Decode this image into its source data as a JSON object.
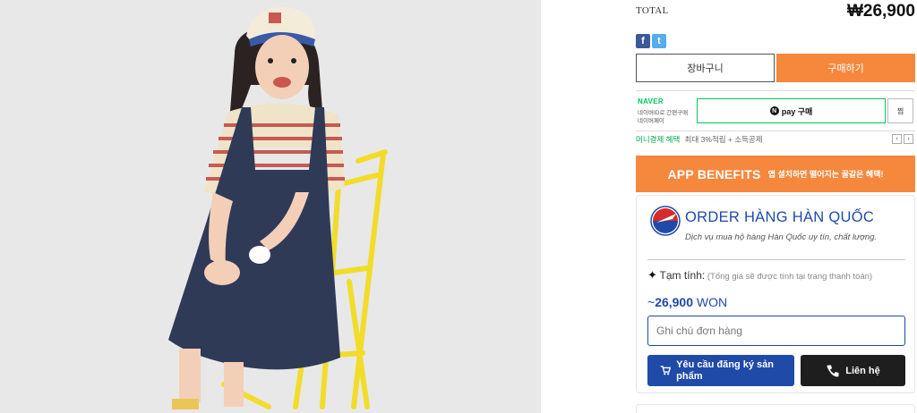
{
  "total": {
    "label": "TOTAL",
    "price": "₩26,900"
  },
  "share": {
    "facebook_glyph": "f",
    "twitter_glyph": "t"
  },
  "buttons": {
    "cart": "장바구니",
    "buy": "구매하기"
  },
  "naver_pay": {
    "logo": "NAVER",
    "sub1": "네이버ID로 간편구매",
    "sub2": "네이버페이",
    "n_glyph": "N",
    "pay_label": "pay 구매",
    "wish": "찜"
  },
  "benefit": {
    "title": "머니결제 혜택",
    "text": "최대 3%적립 + 소득공제",
    "prev": "‹",
    "next": "›"
  },
  "app_banner": {
    "title": "APP BENEFITS",
    "subtitle": "앱 설치하면 떨어지는 꿀같은 혜택!"
  },
  "order_card": {
    "title": "ORDER HÀNG HÀN QUỐC",
    "description": "Dịch vụ mua hộ hàng Hàn Quốc uy tín, chất lượng.",
    "estimate_star": "✦",
    "estimate_label": "Tạm tính:",
    "estimate_note": "(Tổng giá sẽ được tính tại trang thanh toán)",
    "approx_sign": "~",
    "won_amount": "26,900",
    "won_unit": "WON",
    "note_placeholder": "Ghi chú đơn hàng",
    "request_button": "Yêu cầu đăng ký sản phẩm",
    "contact_button": "Liên hệ"
  },
  "colors": {
    "accent_orange": "#f5883d",
    "brand_blue": "#1f4aa8",
    "naver_green": "#03c75a"
  }
}
